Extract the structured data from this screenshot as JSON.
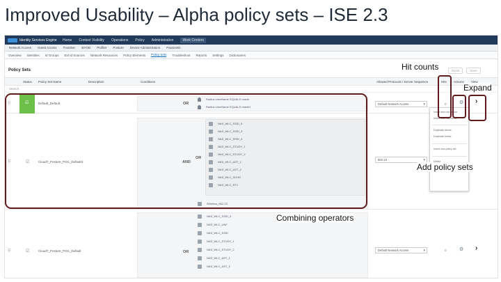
{
  "slide": {
    "title": "Improved Usability – Alpha policy sets – ISE 2.3"
  },
  "app": {
    "brand": "Identity Services Engine",
    "nav": [
      "Home",
      "Context Visibility",
      "Operations",
      "Policy",
      "Administration",
      "Work Centers"
    ],
    "active_nav": "Work Centers",
    "subnav": [
      "Network Access",
      "Guest Access",
      "TrustSec",
      "BYOD",
      "Profiler",
      "Posture",
      "Device Administration",
      "PassiveID"
    ],
    "tabs": [
      "Overview",
      "Identities",
      "Id Groups",
      "Ext Id Sources",
      "Network Resources",
      "Policy Elements",
      "Policy Sets",
      "Troubleshoot",
      "Reports",
      "Settings",
      "Dictionaries"
    ],
    "active_tab": "Policy Sets"
  },
  "policy_sets": {
    "title": "Policy Sets",
    "reset_label": "Reset",
    "save_label": "Save",
    "columns": [
      "Status",
      "Policy Set Name",
      "Description",
      "Conditions",
      "Allowed Protocols / Server Sequence",
      "Hits",
      "Actions",
      "View"
    ],
    "search_label": "Search",
    "rows": [
      {
        "name": "Default_Default",
        "operator": "OR",
        "conditions": [
          "Radius·UserName EQUALS oracle",
          "Radius·UserName EQUALS oracle1"
        ],
        "protocol": "Default Network Access",
        "hits": "0"
      },
      {
        "name": "CloudT_Posture_POC_DefaultX",
        "operator": "AND",
        "inner_operator": "OR",
        "conditions": [
          "NAS_WLC_SSID_5",
          "NAS_WLC_SSID_3",
          "NAS_WLC_SSID_4",
          "NAS_WLC_STUDY_1",
          "NAS_WLC_STUDY_2",
          "NAS_WLC_AST_1",
          "NAS_WLC_AST_2",
          "NAS_WLC_SCHO",
          "NAS_WLC_RT1",
          "Wireless_802.1X"
        ],
        "protocol": "802.1X",
        "hits": "0"
      },
      {
        "name": "CloudT_Posture_POC_Default",
        "operator": "OR",
        "conditions": [
          "NAS_WLC_SSID_5",
          "NAS_WLC_UNF",
          "NAS_WLC_SSID",
          "NAS_WLC_STUDY_1",
          "NAS_WLC_STUDY_2",
          "NAS_WLC_AST_1",
          "NAS_WLC_AST_2"
        ],
        "protocol": "Default Network Access",
        "hits": "0"
      }
    ]
  },
  "actions_menu": {
    "items": [
      "Insert new row above",
      "Insert new row below",
      "Duplicate above",
      "Duplicate below",
      "Insert new policy set",
      "Delete"
    ]
  },
  "callouts": {
    "hit_counts": "Hit counts",
    "expand": "Expand",
    "add_policy_sets": "Add policy sets",
    "combining_operators": "Combining operators"
  },
  "colors": {
    "title": "#1f2a36",
    "highlight": "#5e1a1c",
    "status_enabled": "#6cc04a",
    "app_header": "#223a59"
  }
}
